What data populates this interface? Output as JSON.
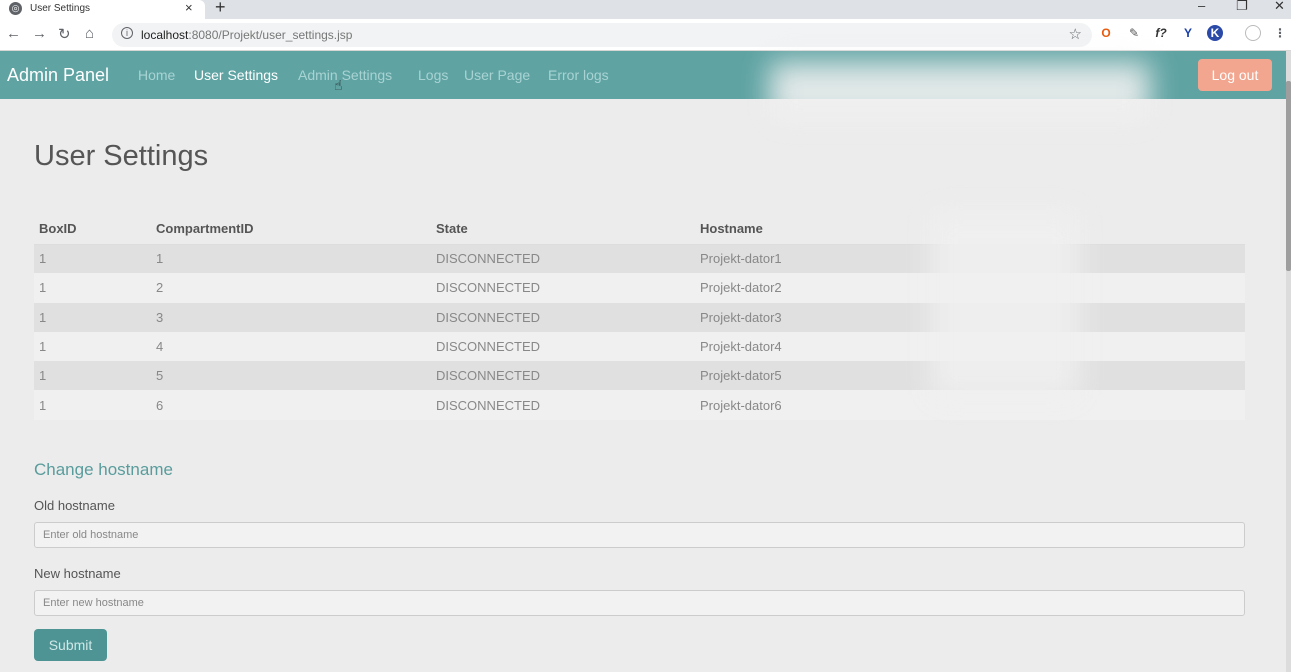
{
  "browser": {
    "tab_title": "User Settings",
    "tab_close": "×",
    "new_tab": "+",
    "url_host": "localhost",
    "url_path": ":8080/Projekt/user_settings.jsp"
  },
  "navbar": {
    "brand": "Admin Panel",
    "links": [
      "Home",
      "User Settings",
      "Admin Settings",
      "Logs",
      "User Page",
      "Error logs"
    ],
    "logout": "Log out"
  },
  "page": {
    "title": "User Settings"
  },
  "table": {
    "headers": [
      "BoxID",
      "CompartmentID",
      "State",
      "Hostname"
    ],
    "rows": [
      [
        "1",
        "1",
        "DISCONNECTED",
        "Projekt-dator1"
      ],
      [
        "1",
        "2",
        "DISCONNECTED",
        "Projekt-dator2"
      ],
      [
        "1",
        "3",
        "DISCONNECTED",
        "Projekt-dator3"
      ],
      [
        "1",
        "4",
        "DISCONNECTED",
        "Projekt-dator4"
      ],
      [
        "1",
        "5",
        "DISCONNECTED",
        "Projekt-dator5"
      ],
      [
        "1",
        "6",
        "DISCONNECTED",
        "Projekt-dator6"
      ]
    ]
  },
  "form": {
    "title": "Change hostname",
    "old_label": "Old hostname",
    "old_placeholder": "Enter old hostname",
    "new_label": "New hostname",
    "new_placeholder": "Enter new hostname",
    "submit": "Submit"
  },
  "colors": {
    "navbar": "#5fa3a3",
    "logout": "#f3a68f",
    "submit": "#4e9494",
    "section_title": "#5a9c9c"
  }
}
